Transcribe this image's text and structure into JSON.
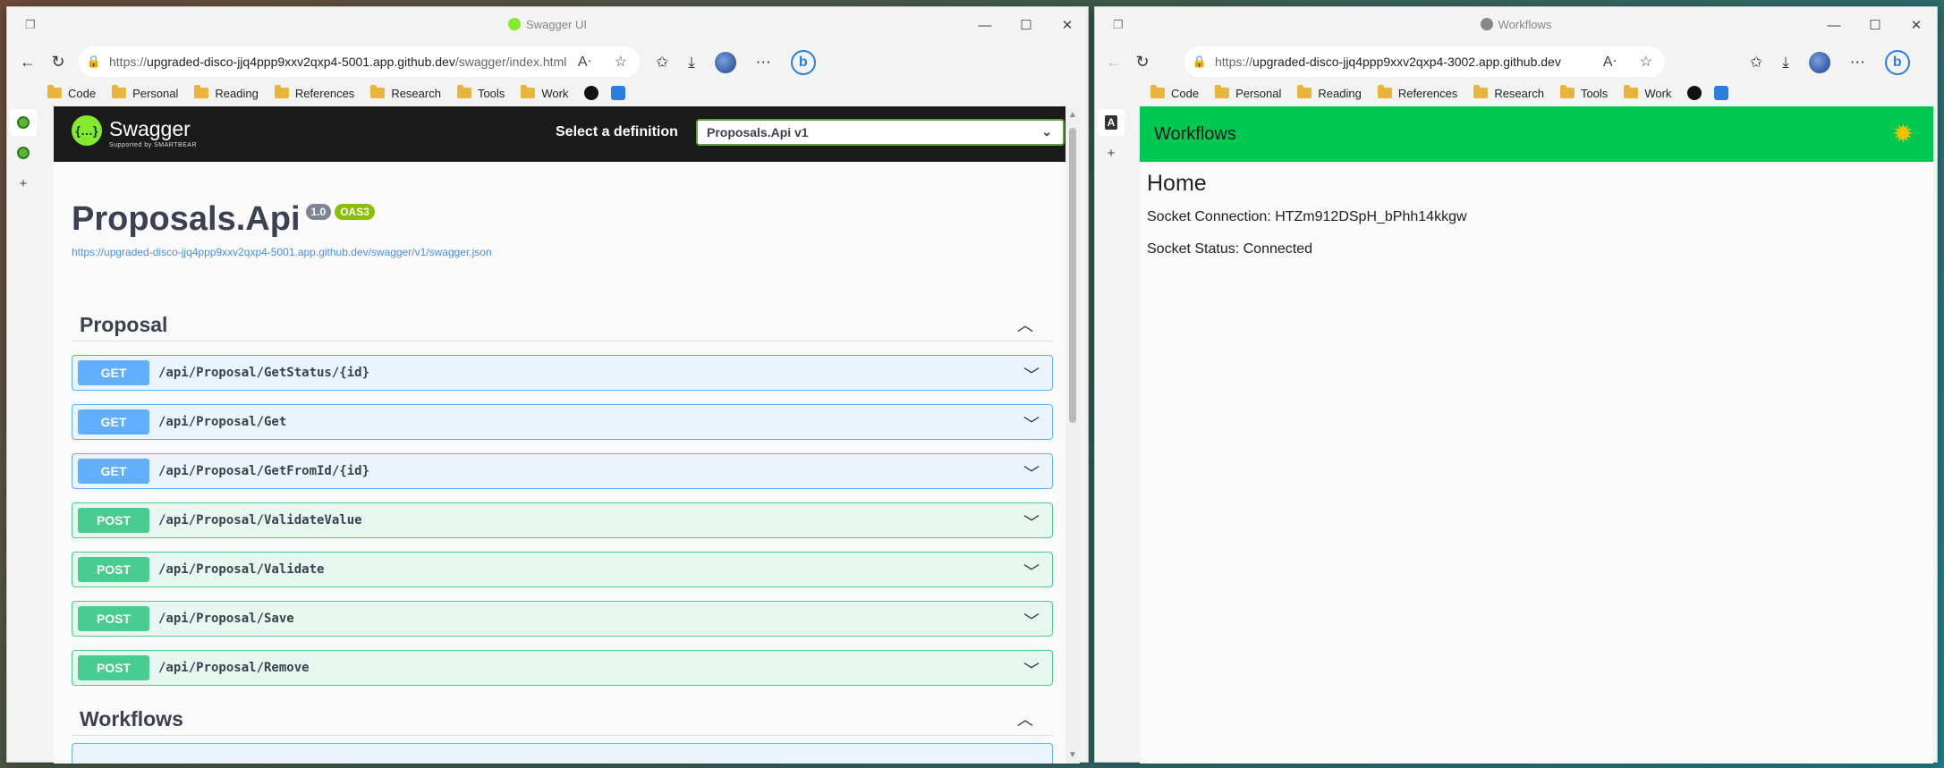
{
  "left_window": {
    "title": "Swagger UI",
    "url_prefix": "https://",
    "url_host": "upgraded-disco-jjq4ppp9xxv2qxp4-5001.app.github.dev",
    "url_path": "/swagger/index.html",
    "bookmarks": [
      "Code",
      "Personal",
      "Reading",
      "References",
      "Research",
      "Tools",
      "Work"
    ],
    "swagger": {
      "brand": "Swagger",
      "brand_sub": "Supported by SMARTBEAR",
      "select_label": "Select a definition",
      "selected_definition": "Proposals.Api v1",
      "api_title": "Proposals.Api",
      "version_badge": "1.0",
      "oas_badge": "OAS3",
      "spec_link": "https://upgraded-disco-jjq4ppp9xxv2qxp4-5001.app.github.dev/swagger/v1/swagger.json",
      "sections": [
        {
          "name": "Proposal",
          "operations": [
            {
              "method": "GET",
              "path": "/api/Proposal/GetStatus/{id}"
            },
            {
              "method": "GET",
              "path": "/api/Proposal/Get"
            },
            {
              "method": "GET",
              "path": "/api/Proposal/GetFromId/{id}"
            },
            {
              "method": "POST",
              "path": "/api/Proposal/ValidateValue"
            },
            {
              "method": "POST",
              "path": "/api/Proposal/Validate"
            },
            {
              "method": "POST",
              "path": "/api/Proposal/Save"
            },
            {
              "method": "POST",
              "path": "/api/Proposal/Remove"
            }
          ]
        },
        {
          "name": "Workflows"
        }
      ]
    }
  },
  "right_window": {
    "title": "Workflows",
    "url_prefix": "https://",
    "url_host": "upgraded-disco-jjq4ppp9xxv2qxp4-3002.app.github.dev",
    "bookmarks": [
      "Code",
      "Personal",
      "Reading",
      "References",
      "Research",
      "Tools",
      "Work"
    ],
    "app": {
      "header_title": "Workflows",
      "page_heading": "Home",
      "socket_connection_label": "Socket Connection: HTZm912DSpH_bPhh14kkgw",
      "socket_status_label": "Socket Status: Connected"
    }
  },
  "colors": {
    "get": "#61affe",
    "post": "#49cc90",
    "workflows_header": "#00c851",
    "swagger_green": "#85ea2d"
  },
  "icons": [
    "tab-actions-icon",
    "back-icon",
    "refresh-icon",
    "lock-icon",
    "read-aloud-icon",
    "favorite-icon",
    "favorites-icon",
    "downloads-icon",
    "more-icon",
    "bing-icon",
    "theme-sun-icon"
  ]
}
